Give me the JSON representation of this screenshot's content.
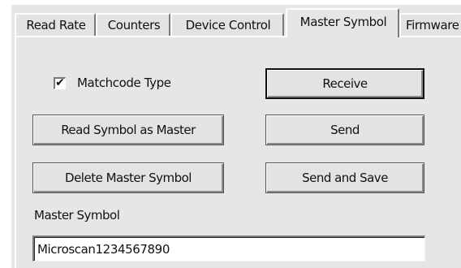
{
  "tabs": [
    {
      "label": "Read Rate",
      "active": false
    },
    {
      "label": "Counters",
      "active": false
    },
    {
      "label": "Device Control",
      "active": false
    },
    {
      "label": "Master Symbol",
      "active": true
    },
    {
      "label": "Firmware",
      "active": false
    }
  ],
  "matchcode": {
    "label": "Matchcode Type",
    "checked": true,
    "check_glyph": "✔"
  },
  "buttons": {
    "receive": "Receive",
    "read_symbol": "Read Symbol as Master",
    "send": "Send",
    "delete_master": "Delete Master Symbol",
    "send_and_save": "Send and Save"
  },
  "master_symbol": {
    "label": "Master Symbol",
    "value": "Microscan1234567890"
  }
}
